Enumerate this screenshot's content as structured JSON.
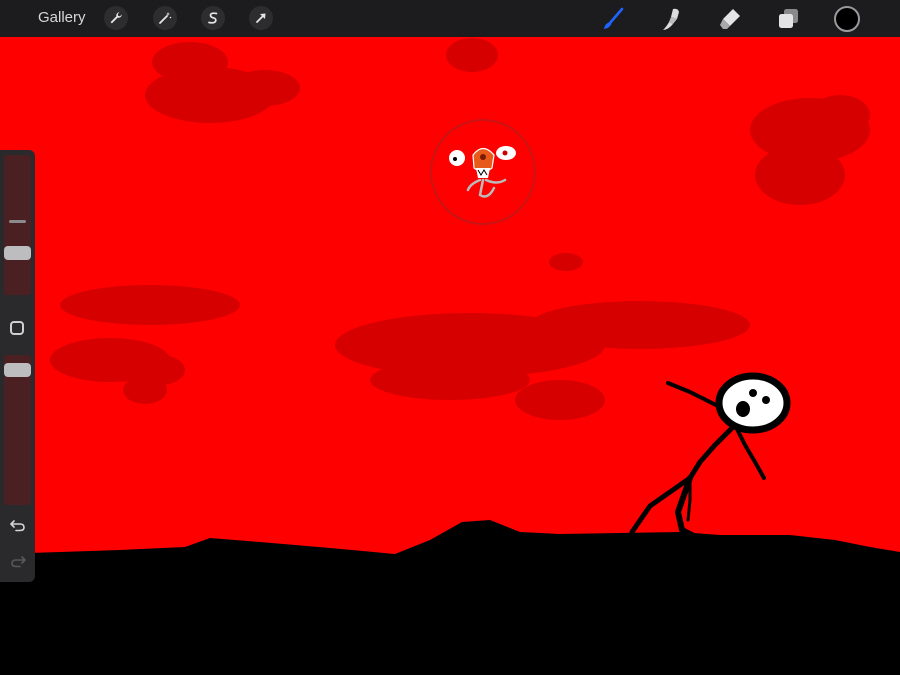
{
  "app": {
    "gallery_label": "Gallery"
  },
  "toolbar_left": {
    "icons": [
      "wrench-icon",
      "magic-wand-icon",
      "selection-s-icon",
      "transform-arrow-icon"
    ]
  },
  "toolbar_right": {
    "icons": [
      "brush-icon",
      "smudge-icon",
      "eraser-icon",
      "layers-icon"
    ],
    "active_tool": "brush",
    "active_color": "#1e64ff",
    "current_color": "#000000"
  },
  "sidebar": {
    "brush_size_level": 0.3,
    "opacity_level": 0.95,
    "icons": [
      "modify-square-icon",
      "undo-icon",
      "redo-icon"
    ],
    "redo_enabled": false
  },
  "canvas": {
    "background_color": "#ff0000",
    "cloud_color": "#d80000",
    "ground_color": "#000000"
  }
}
